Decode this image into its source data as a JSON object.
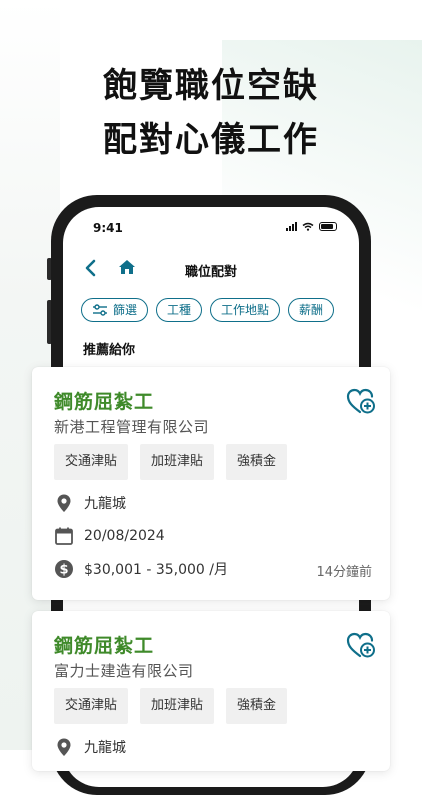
{
  "headline": {
    "line1": "飽覽職位空缺",
    "line2": "配對心儀工作"
  },
  "status": {
    "time": "9:41"
  },
  "nav": {
    "title": "職位配對"
  },
  "chips": [
    {
      "label": "篩選",
      "icon": "filter-icon"
    },
    {
      "label": "工種"
    },
    {
      "label": "工作地點"
    },
    {
      "label": "薪酬"
    }
  ],
  "section_title": "推薦給你",
  "jobs": [
    {
      "title": "鋼筋屈紮工",
      "company": "新港工程管理有限公司",
      "tags": [
        "交通津貼",
        "加班津貼",
        "強積金"
      ],
      "location": "九龍城",
      "date": "20/08/2024",
      "salary": "$30,001 - 35,000 /月",
      "posted": "14分鐘前"
    },
    {
      "title": "鋼筋屈紮工",
      "company": "富力士建造有限公司",
      "tags": [
        "交通津貼",
        "加班津貼",
        "強積金"
      ],
      "location": "九龍城"
    }
  ],
  "colors": {
    "accent": "#0f6f8a",
    "job_title": "#3f8a2a",
    "icon_gray": "#555555"
  }
}
